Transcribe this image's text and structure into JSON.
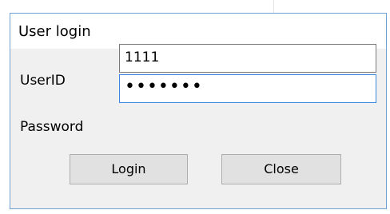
{
  "dialog": {
    "title": "User login",
    "userid_label": "UserID",
    "userid_value": "1111",
    "password_label": "Password",
    "password_masked": "•••••••",
    "login_label": "Login",
    "close_label": "Close"
  },
  "colors": {
    "border": "#6d9fd4",
    "client_bg": "#f0f0f0",
    "focus_border": "#3c8be0",
    "button_bg": "#e1e1e1"
  }
}
